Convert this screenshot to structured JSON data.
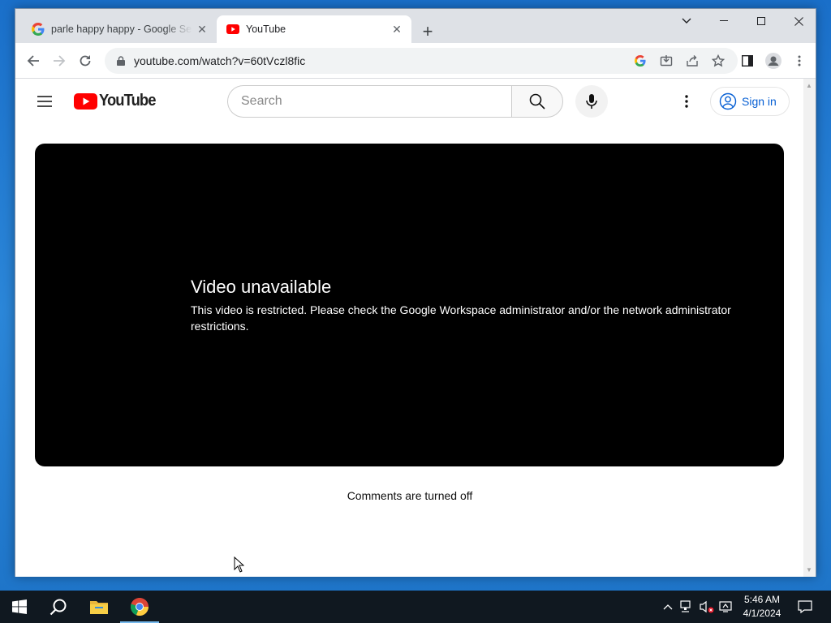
{
  "browser": {
    "tabs": [
      {
        "title": "parle happy happy - Google Sear",
        "favicon": "google-g-icon",
        "active": false
      },
      {
        "title": "YouTube",
        "favicon": "youtube-icon",
        "active": true
      }
    ],
    "url": "youtube.com/watch?v=60tVczl8fic",
    "toolbar_icons": [
      "back-icon",
      "forward-icon",
      "reload-icon",
      "lock-icon",
      "google-lens-icon",
      "install-icon",
      "share-icon",
      "bookmark-star-icon",
      "side-panel-icon",
      "profile-icon",
      "menu-dots-icon"
    ]
  },
  "youtube": {
    "logo_text": "YouTube",
    "search_placeholder": "Search",
    "signin_label": "Sign in",
    "player": {
      "error_title": "Video unavailable",
      "error_message": "This video is restricted. Please check the Google Workspace administrator and/or the network administrator restrictions."
    },
    "comments_status": "Comments are turned off"
  },
  "taskbar": {
    "apps": [
      "start-icon",
      "search-icon",
      "file-explorer-icon",
      "chrome-icon"
    ],
    "time": "5:46 AM",
    "date": "4/1/2024"
  },
  "colors": {
    "youtube_red": "#ff0000",
    "signin_blue": "#065fd4",
    "taskbar_bg": "#101820",
    "desktop_blue": "#1a6fc9"
  }
}
